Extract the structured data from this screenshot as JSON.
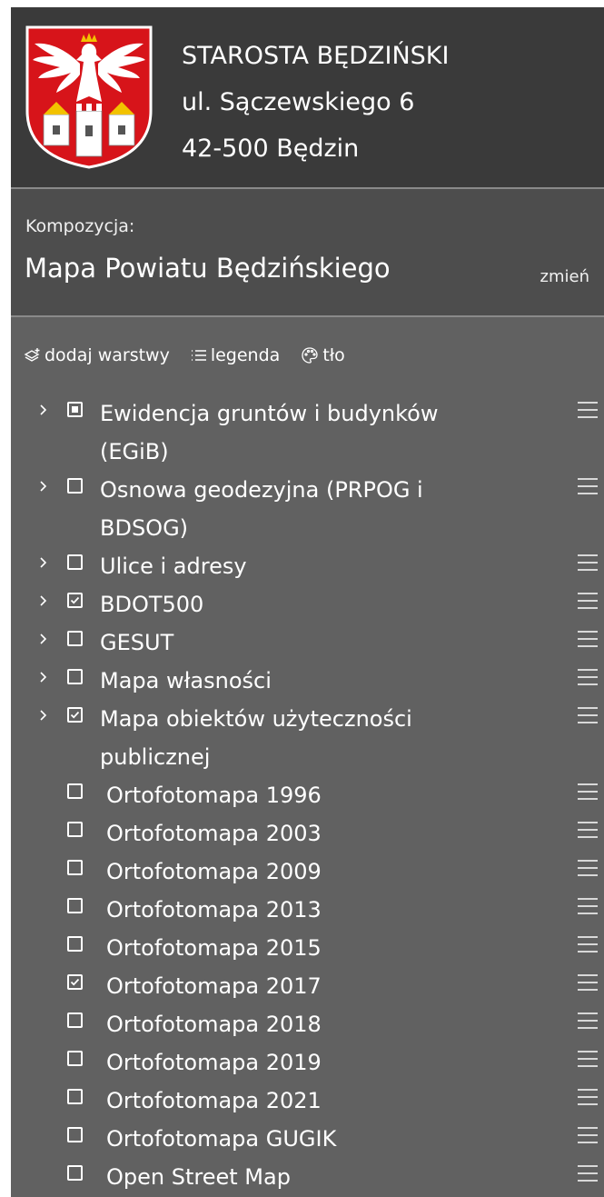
{
  "header": {
    "line1": "STAROSTA BĘDZIŃSKI",
    "line2": "ul. Sączewskiego 6",
    "line3": "42-500 Będzin",
    "crest_colors": {
      "shield": "#d7141a",
      "eagle": "#ffffff",
      "crown": "#f2c200"
    }
  },
  "composition": {
    "label": "Kompozycja:",
    "name": "Mapa Powiatu Będzińskiego",
    "change": "zmień"
  },
  "toolbar": {
    "add_layers": "dodaj warstwy",
    "legend": "legenda",
    "background": "tło"
  },
  "layers": [
    {
      "label": "Ewidencja gruntów i budynków (EGiB)",
      "state": "partial",
      "expandable": true
    },
    {
      "label": "Osnowa geodezyjna (PRPOG i BDSOG)",
      "state": "unchecked",
      "expandable": true
    },
    {
      "label": "Ulice i adresy",
      "state": "unchecked",
      "expandable": true
    },
    {
      "label": "BDOT500",
      "state": "checked",
      "expandable": true
    },
    {
      "label": "GESUT",
      "state": "unchecked",
      "expandable": true
    },
    {
      "label": "Mapa własności",
      "state": "unchecked",
      "expandable": true
    },
    {
      "label": "Mapa obiektów użyteczności publicznej",
      "state": "checked",
      "expandable": true
    },
    {
      "label": "Ortofotomapa 1996",
      "state": "unchecked",
      "expandable": false
    },
    {
      "label": "Ortofotomapa 2003",
      "state": "unchecked",
      "expandable": false
    },
    {
      "label": "Ortofotomapa 2009",
      "state": "unchecked",
      "expandable": false
    },
    {
      "label": "Ortofotomapa 2013",
      "state": "unchecked",
      "expandable": false
    },
    {
      "label": "Ortofotomapa 2015",
      "state": "unchecked",
      "expandable": false
    },
    {
      "label": "Ortofotomapa 2017",
      "state": "checked",
      "expandable": false
    },
    {
      "label": "Ortofotomapa 2018",
      "state": "unchecked",
      "expandable": false
    },
    {
      "label": "Ortofotomapa 2019",
      "state": "unchecked",
      "expandable": false
    },
    {
      "label": "Ortofotomapa 2021",
      "state": "unchecked",
      "expandable": false
    },
    {
      "label": "Ortofotomapa GUGIK",
      "state": "unchecked",
      "expandable": false
    },
    {
      "label": "Open Street Map",
      "state": "unchecked",
      "expandable": false
    }
  ]
}
